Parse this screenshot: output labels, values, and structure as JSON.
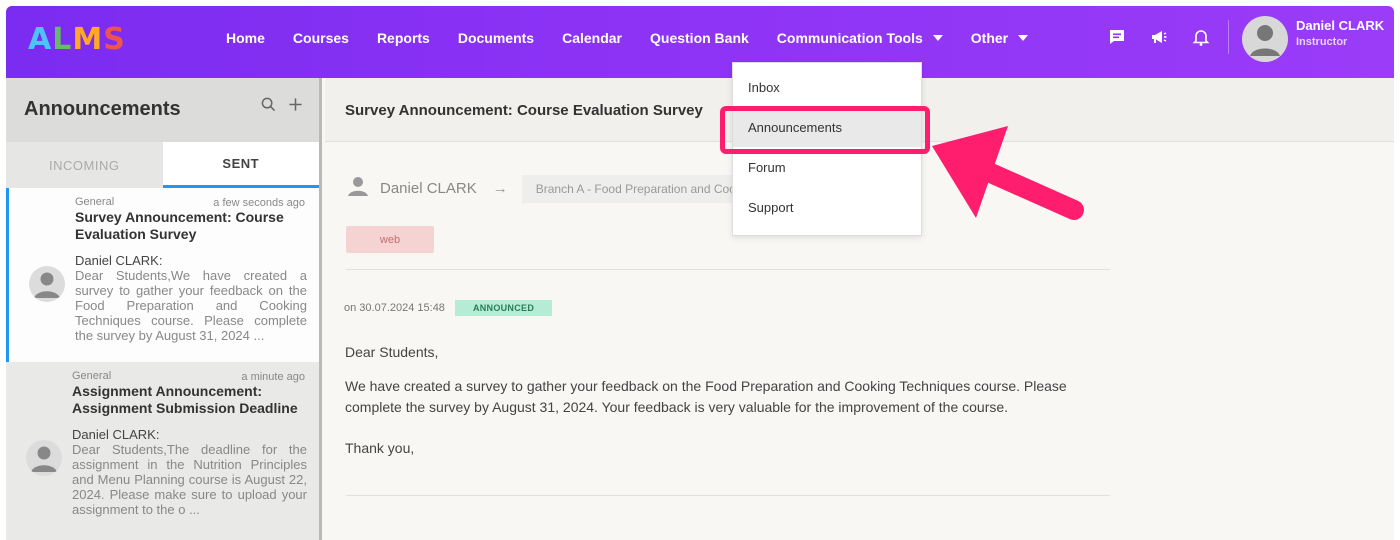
{
  "app": {
    "logo_text": "ALMS",
    "logo_letters": [
      {
        "ch": "A",
        "color": "#4fc3f7"
      },
      {
        "ch": "L",
        "color": "#66bb6a"
      },
      {
        "ch": "M",
        "color": "#ffa726"
      },
      {
        "ch": "S",
        "color": "#ef5350"
      }
    ],
    "brand_color": "#8b32f5",
    "accent_color": "#2196f3",
    "highlight_color": "#ff1e6e"
  },
  "nav": {
    "items": [
      {
        "label": "Home"
      },
      {
        "label": "Courses"
      },
      {
        "label": "Reports"
      },
      {
        "label": "Documents"
      },
      {
        "label": "Calendar"
      },
      {
        "label": "Question Bank"
      },
      {
        "label": "Communication Tools"
      },
      {
        "label": "Other"
      }
    ],
    "icons": [
      "chat-icon",
      "megaphone-icon",
      "bell-icon"
    ]
  },
  "user": {
    "name": "Daniel CLARK",
    "role": "Instructor"
  },
  "dropdown": {
    "items": [
      {
        "label": "Inbox"
      },
      {
        "label": "Announcements",
        "highlighted": true
      },
      {
        "label": "Forum"
      },
      {
        "label": "Support"
      }
    ]
  },
  "sidebar": {
    "title": "Announcements",
    "tabs": [
      {
        "label": "INCOMING",
        "active": false
      },
      {
        "label": "SENT",
        "active": true
      }
    ],
    "items": [
      {
        "category": "General",
        "time": "a few seconds ago",
        "title": "Survey Announcement: Course Evaluation Survey",
        "author": "Daniel CLARK:",
        "preview": "Dear Students,We have created a survey to gather your feedback on the Food Preparation and Cooking Techniques course. Please complete the survey by August 31, 2024 ..."
      },
      {
        "category": "General",
        "time": "a minute ago",
        "title": "Assignment Announcement: Assignment Submission Deadline",
        "author": "Daniel CLARK:",
        "preview": "Dear Students,The deadline for the assignment in the Nutrition Principles and Menu Planning course is August 22, 2024. Please make sure to upload your assignment to the o ..."
      }
    ]
  },
  "main": {
    "title": "Survey Announcement: Course Evaluation Survey",
    "sender": "Daniel CLARK",
    "recipient": "Branch A - Food Preparation and Cooking Techniques",
    "tag": "web",
    "date_text": "on 30.07.2024 15:48",
    "status": "ANNOUNCED",
    "greeting": "Dear Students,",
    "body": "We have created a survey to gather your feedback on the Food Preparation and Cooking Techniques course. Please complete the survey by August 31, 2024. Your feedback is very valuable for the improvement of the course.",
    "closing": "Thank you,"
  }
}
